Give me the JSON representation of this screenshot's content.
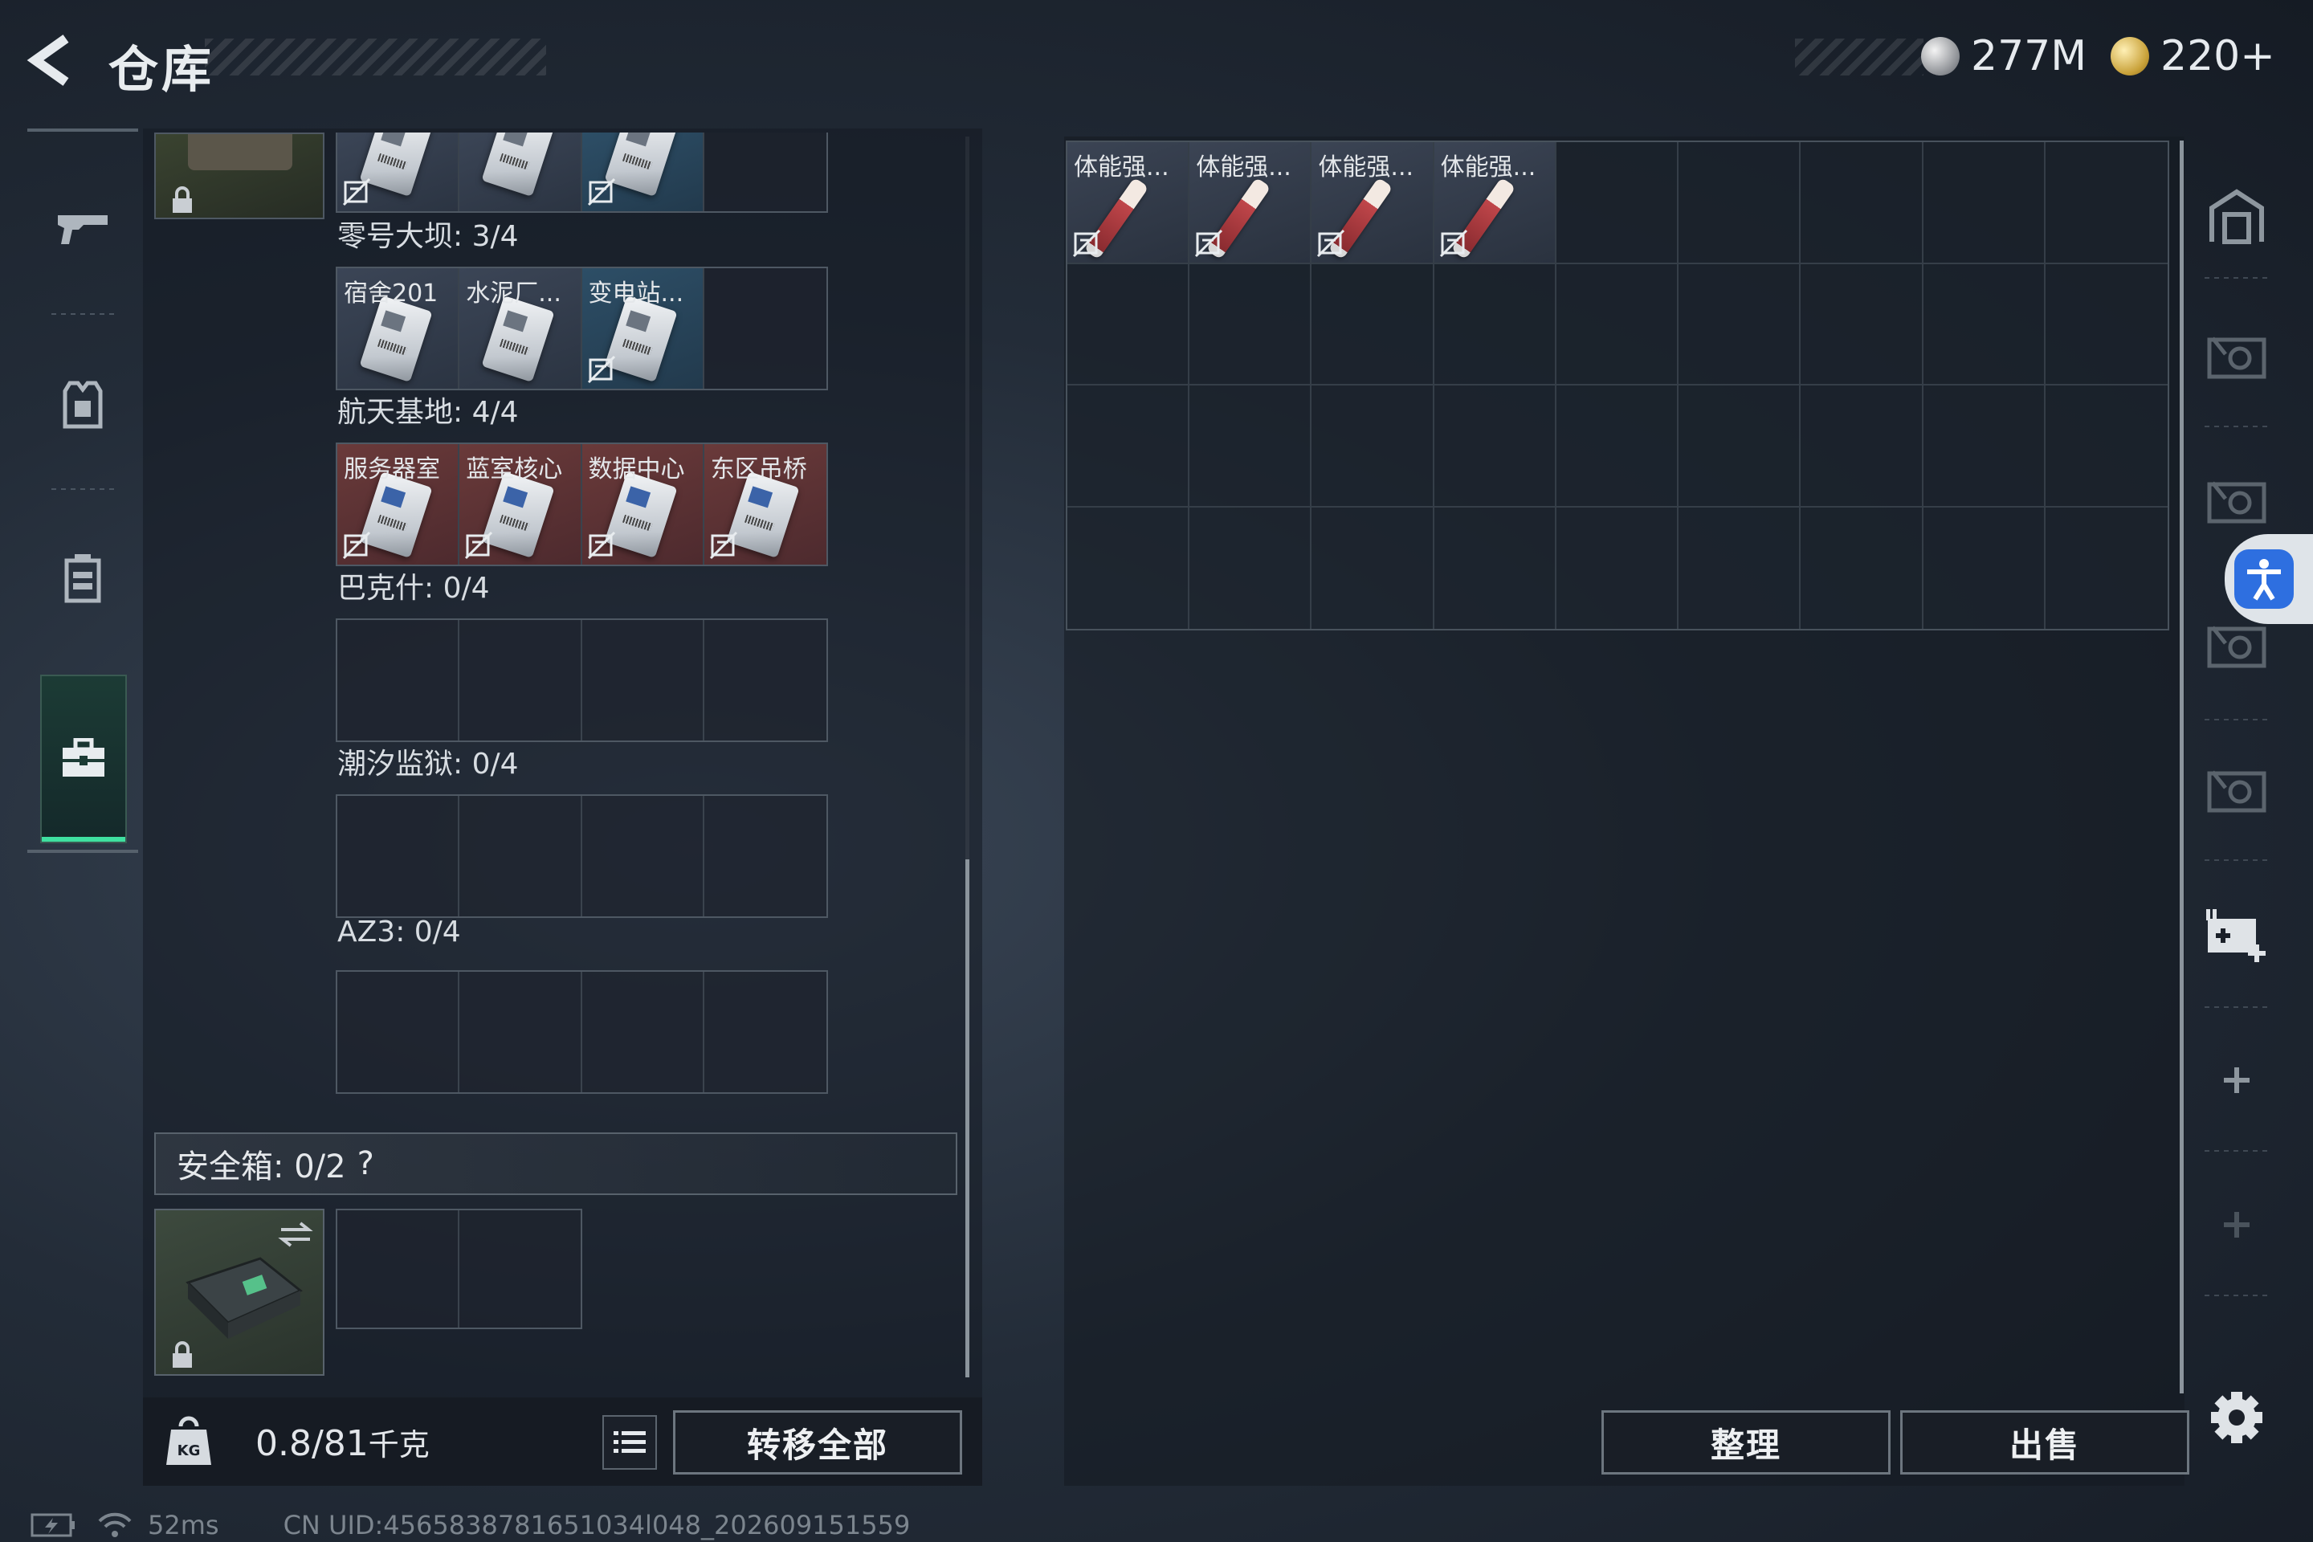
{
  "header": {
    "title": "仓库",
    "currency_silver": "277M",
    "currency_gold": "220+"
  },
  "left_top_partial": [
    {
      "name": "",
      "color": "filled",
      "nomark": true
    },
    {
      "name": "",
      "color": "filled",
      "nomark": false
    },
    {
      "name": "",
      "color": "blue",
      "nomark": true
    }
  ],
  "key_groups": [
    {
      "label": "零号大坝: 3/4",
      "slots": [
        {
          "name": "宿舍201",
          "color": "filled",
          "nomark": false,
          "card": "dark"
        },
        {
          "name": "水泥厂...",
          "color": "filled",
          "nomark": false,
          "card": "dark"
        },
        {
          "name": "变电站...",
          "color": "blue",
          "nomark": true,
          "card": "dark"
        },
        null
      ]
    },
    {
      "label": "航天基地: 4/4",
      "slots": [
        {
          "name": "服务器室",
          "color": "red",
          "nomark": true,
          "card": "blue"
        },
        {
          "name": "蓝室核心",
          "color": "red",
          "nomark": true,
          "card": "blue"
        },
        {
          "name": "数据中心",
          "color": "red",
          "nomark": true,
          "card": "blue"
        },
        {
          "name": "东区吊桥",
          "color": "red",
          "nomark": true,
          "card": "blue"
        }
      ]
    },
    {
      "label": "巴克什: 0/4",
      "slots": [
        null,
        null,
        null,
        null
      ]
    },
    {
      "label": "潮汐监狱: 0/4",
      "slots": [
        null,
        null,
        null,
        null
      ]
    },
    {
      "label": "AZ3: 0/4",
      "slots": [
        null,
        null,
        null,
        null
      ]
    }
  ],
  "safe_box": {
    "label": "安全箱: 0/2",
    "help": "?"
  },
  "bottom_left": {
    "weight_value": "0.8/81",
    "weight_unit": "千克",
    "transfer_all": "转移全部"
  },
  "stash_items": [
    {
      "name": "体能强..."
    },
    {
      "name": "体能强..."
    },
    {
      "name": "体能强..."
    },
    {
      "name": "体能强..."
    }
  ],
  "bottom_right": {
    "sort_label": "整理",
    "sell_label": "出售"
  },
  "status_bar": {
    "ping": "52ms",
    "uid": "CN UID:4565838781651034l048_202609151559"
  },
  "colors": {
    "accent_green": "#3fe0a0",
    "access_blue": "#2e6fe0",
    "red_slot": "#6a3a3a",
    "blue_slot": "#2d4e66"
  }
}
